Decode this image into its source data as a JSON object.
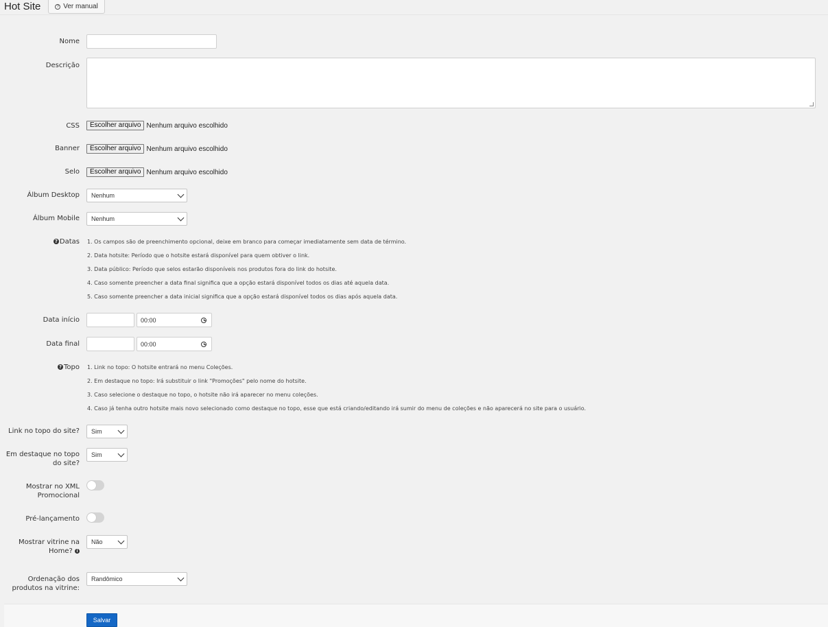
{
  "header": {
    "title": "Hot Site",
    "manual_button": "Ver manual"
  },
  "form": {
    "nome_label": "Nome",
    "descricao_label": "Descrição",
    "css_label": "CSS",
    "banner_label": "Banner",
    "selo_label": "Selo",
    "file_button": "Escolher arquivo",
    "file_status": "Nenhum arquivo escolhido",
    "album_desktop_label": "Álbum Desktop",
    "album_desktop_value": "Nenhum",
    "album_mobile_label": "Álbum Mobile",
    "album_mobile_value": "Nenhum",
    "datas_label": "Datas",
    "datas_notes": [
      "1. Os campos são de preenchimento opcional, deixe em branco para começar imediatamente sem data de término.",
      "2. Data hotsite: Período que o hotsite estará disponível para quem obtiver o link.",
      "3. Data público: Período que selos estarão disponíveis nos produtos fora do link do hotsite.",
      "4. Caso somente preencher a data final significa que a opção estará disponível todos os dias até aquela data.",
      "5. Caso somente preencher a data inicial significa que a opção estará disponível todos os dias após aquela data."
    ],
    "data_inicio_label": "Data início",
    "data_inicio_time": "00:00",
    "data_final_label": "Data final",
    "data_final_time": "00:00",
    "topo_label": "Topo",
    "topo_notes": [
      "1. Link no topo: O hotsite entrará no menu Coleções.",
      "2. Em destaque no topo: Irá substituir o link \"Promoções\" pelo nome do hotsite.",
      "3. Caso selecione o destaque no topo, o hotsite não irá aparecer no menu coleções.",
      "4. Caso já tenha outro hotsite mais novo selecionado como destaque no topo, esse que está criando/editando irá sumir do menu de coleções e não aparecerá no site para o usuário."
    ],
    "link_topo_label": "Link no topo do site?",
    "link_topo_value": "Sim",
    "destaque_topo_label": "Em destaque no topo do site?",
    "destaque_topo_value": "Sim",
    "xml_label": "Mostrar no XML Promocional",
    "prelancamento_label": "Pré-lançamento",
    "vitrine_label": "Mostrar vitrine na Home?",
    "vitrine_value": "Não",
    "ordenacao_label": "Ordenação dos produtos na vitrine:",
    "ordenacao_value": "Randômico",
    "save_button": "Salvar"
  }
}
